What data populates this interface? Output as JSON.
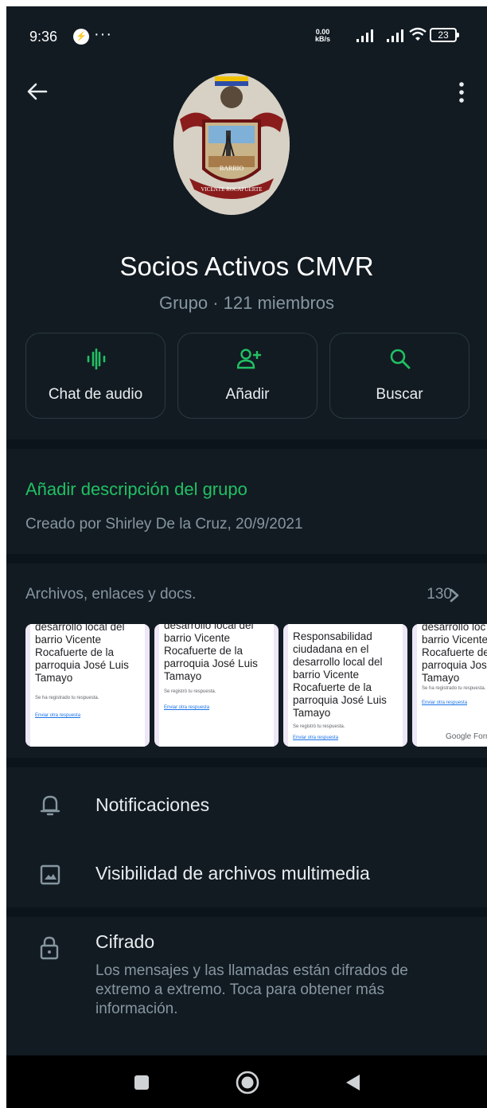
{
  "status": {
    "time": "9:36",
    "dots": "···",
    "speed_top": "0.00",
    "speed_bottom": "kB/s",
    "battery": "23"
  },
  "group": {
    "name": "Socios Activos CMVR",
    "subtitle": "Grupo · 121 miembros",
    "emblem_text": "VICENTE ROCAFUERTE",
    "emblem_word": "BARRIO"
  },
  "actions": [
    {
      "label": "Chat de audio",
      "icon": "audio-wave-icon"
    },
    {
      "label": "Añadir",
      "icon": "add-person-icon"
    },
    {
      "label": "Buscar",
      "icon": "search-icon"
    }
  ],
  "description": {
    "link": "Añadir descripción del grupo",
    "created": "Creado por Shirley De la Cruz, 20/9/2021"
  },
  "files": {
    "title": "Archivos, enlaces y docs.",
    "count": "130",
    "thumbs": [
      {
        "text": "desarrollo local del barrio Vicente Rocafuerte de la parroquia José Luis Tamayo",
        "note": "Se ha registrado tu respuesta.",
        "link": "Enviar otra respuesta"
      },
      {
        "text": "desarrollo local del barrio Vicente Rocafuerte de la parroquia José Luis Tamayo",
        "note": "Se registró tu respuesta.",
        "link": "Enviar otra respuesta"
      },
      {
        "text": "Responsabilidad ciudadana en el desarrollo local del barrio Vicente Rocafuerte de la parroquia José Luis Tamayo",
        "note": "Se registró tu respuesta.",
        "link": "Enviar otra respuesta"
      },
      {
        "text": "desarrollo loc barrio Vicente Rocafuerte de parroquia Jos Tamayo",
        "note": "Se ha registrado tu respuesta.",
        "link": "Enviar otra respuesta",
        "brand": "Google Formu"
      }
    ]
  },
  "settings": [
    {
      "label": "Notificaciones",
      "icon": "bell-icon"
    },
    {
      "label": "Visibilidad de archivos multimedia",
      "icon": "image-icon"
    }
  ],
  "encryption": {
    "label": "Cifrado",
    "description": "Los mensajes y las llamadas están cifrados de extremo a extremo. Toca para obtener más información.",
    "icon": "lock-icon"
  },
  "colors": {
    "background": "#121b22",
    "accent": "#21c063",
    "secondary_text": "#8696a0"
  }
}
